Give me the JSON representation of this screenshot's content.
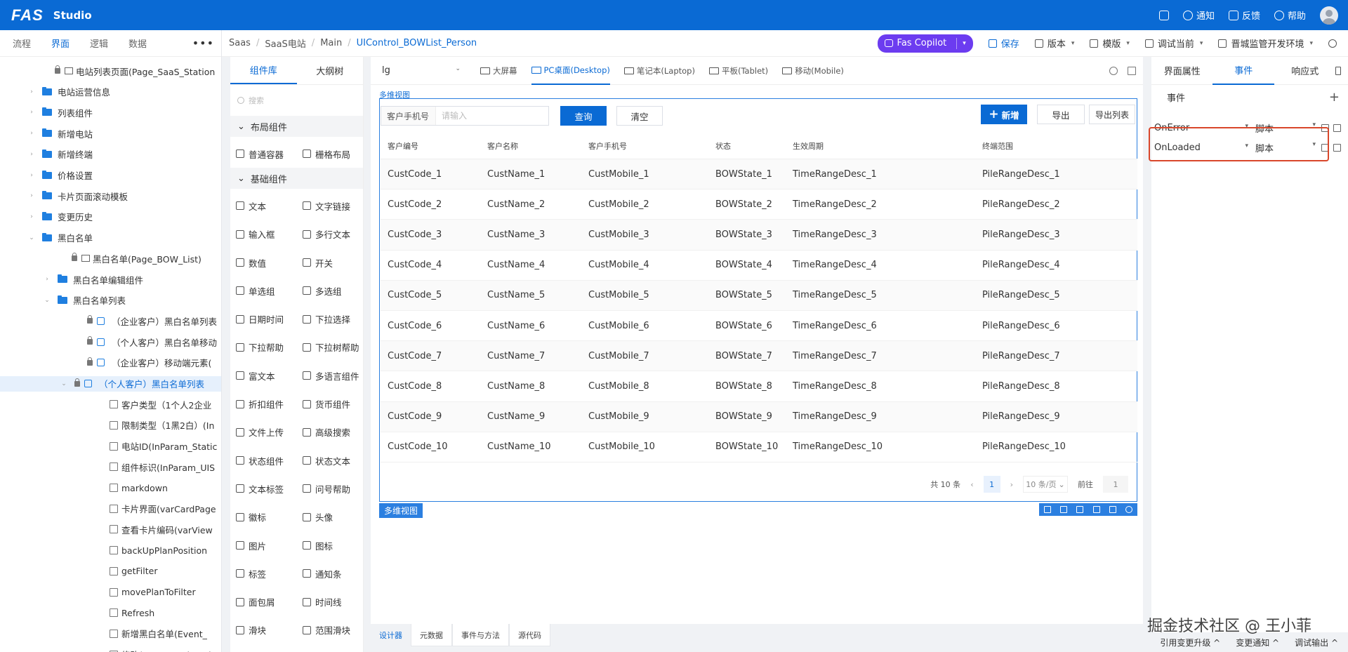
{
  "app": {
    "logo": "FAS",
    "studio": "Studio"
  },
  "topbar": {
    "items": [
      {
        "label": "",
        "icon": "expand-icon"
      },
      {
        "label": "通知",
        "icon": "bell-icon"
      },
      {
        "label": "反馈",
        "icon": "feedback-icon"
      },
      {
        "label": "帮助",
        "icon": "help-icon"
      }
    ]
  },
  "left": {
    "tabs": [
      "流程",
      "界面",
      "逻辑",
      "数据"
    ],
    "active_tab": "界面",
    "tree": [
      {
        "label": "电站列表页面(Page_SaaS_Station",
        "indent": 78,
        "type": "page",
        "lock": true
      },
      {
        "label": "电站运营信息",
        "indent": 60,
        "type": "folder",
        "caret": "›"
      },
      {
        "label": "列表组件",
        "indent": 60,
        "type": "folder",
        "caret": "›"
      },
      {
        "label": "新增电站",
        "indent": 60,
        "type": "folder",
        "caret": "›"
      },
      {
        "label": "新增终端",
        "indent": 60,
        "type": "folder",
        "caret": "›"
      },
      {
        "label": "价格设置",
        "indent": 60,
        "type": "folder",
        "caret": "›"
      },
      {
        "label": "卡片页面滚动模板",
        "indent": 60,
        "type": "folder",
        "caret": "›"
      },
      {
        "label": "变更历史",
        "indent": 60,
        "type": "folder",
        "caret": "›"
      },
      {
        "label": "黑白名单",
        "indent": 60,
        "type": "folder",
        "caret": "⌄"
      },
      {
        "label": "黑白名单(Page_BOW_List)",
        "indent": 102,
        "type": "page",
        "lock": true
      },
      {
        "label": "黑白名单编辑组件",
        "indent": 82,
        "type": "folder",
        "caret": "›"
      },
      {
        "label": "黑白名单列表",
        "indent": 82,
        "type": "folder",
        "caret": "⌄"
      },
      {
        "label": "（企业客户）黑白名单列表",
        "indent": 124,
        "type": "comp",
        "lock": true
      },
      {
        "label": "（个人客户）黑白名单移动",
        "indent": 124,
        "type": "comp",
        "lock": true
      },
      {
        "label": "（企业客户）移动端元素(",
        "indent": 124,
        "type": "comp",
        "lock": true
      },
      {
        "label": "（个人客户）黑白名单列表",
        "indent": 106,
        "type": "comp",
        "lock": true,
        "selected": true,
        "caret": "⌄"
      },
      {
        "label": "客户类型（1个人2企业",
        "indent": 156,
        "type": "prop"
      },
      {
        "label": "限制类型（1黑2白）(In",
        "indent": 156,
        "type": "prop"
      },
      {
        "label": "电站ID(InParam_Static",
        "indent": 156,
        "type": "prop"
      },
      {
        "label": "组件标识(InParam_UIS",
        "indent": 156,
        "type": "prop"
      },
      {
        "label": "markdown",
        "indent": 156,
        "type": "prop"
      },
      {
        "label": "卡片界面(varCardPage",
        "indent": 156,
        "type": "prop"
      },
      {
        "label": "查看卡片编码(varView",
        "indent": 156,
        "type": "prop"
      },
      {
        "label": "backUpPlanPosition",
        "indent": 156,
        "type": "prop"
      },
      {
        "label": "getFilter",
        "indent": 156,
        "type": "prop"
      },
      {
        "label": "movePlanToFilter",
        "indent": 156,
        "type": "prop"
      },
      {
        "label": "Refresh",
        "indent": 156,
        "type": "prop"
      },
      {
        "label": "新增黑白名单(Event_",
        "indent": 156,
        "type": "prop"
      },
      {
        "label": "修改(Event_UpdateLis",
        "indent": 156,
        "type": "prop"
      }
    ]
  },
  "breadcrumb": [
    "Saas",
    "SaaS电站",
    "Main",
    "UIControl_BOWList_Person"
  ],
  "toolbar": {
    "copilot": "Fas Copilot",
    "save": "保存",
    "version": "版本",
    "template": "模版",
    "debug": "调试当前",
    "env": "晋城监管开发环境"
  },
  "library": {
    "tabs": [
      "组件库",
      "大纲树"
    ],
    "search_placeholder": "搜索",
    "groups": [
      {
        "title": "布局组件",
        "items": [
          "普通容器",
          "栅格布局"
        ]
      },
      {
        "title": "基础组件",
        "items": [
          "文本",
          "文字链接",
          "输入框",
          "多行文本",
          "数值",
          "开关",
          "单选组",
          "多选组",
          "日期时间",
          "下拉选择",
          "下拉帮助",
          "下拉树帮助",
          "富文本",
          "多语言组件",
          "折扣组件",
          "货币组件",
          "文件上传",
          "高级搜索",
          "状态组件",
          "状态文本",
          "文本标签",
          "问号帮助",
          "徽标",
          "头像",
          "图片",
          "图标",
          "标签",
          "通知条",
          "面包屑",
          "时间线",
          "滑块",
          "范围滑块"
        ]
      }
    ]
  },
  "designer": {
    "size": "lg",
    "devices": [
      "大屏幕",
      "PC桌面(Desktop)",
      "笔记本(Laptop)",
      "平板(Tablet)",
      "移动(Mobile)"
    ],
    "active_device": "PC桌面(Desktop)",
    "view_label": "多维视图",
    "view_tag": "多维视图",
    "filter_label": "客户手机号",
    "filter_placeholder": "请输入",
    "query": "查询",
    "clear": "清空",
    "add": "新增",
    "export": "导出",
    "export_list": "导出列表",
    "columns": [
      "客户编号",
      "客户名称",
      "客户手机号",
      "状态",
      "生效周期",
      "终端范围"
    ],
    "rows": [
      [
        "CustCode_1",
        "CustName_1",
        "CustMobile_1",
        "BOWState_1",
        "TimeRangeDesc_1",
        "PileRangeDesc_1"
      ],
      [
        "CustCode_2",
        "CustName_2",
        "CustMobile_2",
        "BOWState_2",
        "TimeRangeDesc_2",
        "PileRangeDesc_2"
      ],
      [
        "CustCode_3",
        "CustName_3",
        "CustMobile_3",
        "BOWState_3",
        "TimeRangeDesc_3",
        "PileRangeDesc_3"
      ],
      [
        "CustCode_4",
        "CustName_4",
        "CustMobile_4",
        "BOWState_4",
        "TimeRangeDesc_4",
        "PileRangeDesc_4"
      ],
      [
        "CustCode_5",
        "CustName_5",
        "CustMobile_5",
        "BOWState_5",
        "TimeRangeDesc_5",
        "PileRangeDesc_5"
      ],
      [
        "CustCode_6",
        "CustName_6",
        "CustMobile_6",
        "BOWState_6",
        "TimeRangeDesc_6",
        "PileRangeDesc_6"
      ],
      [
        "CustCode_7",
        "CustName_7",
        "CustMobile_7",
        "BOWState_7",
        "TimeRangeDesc_7",
        "PileRangeDesc_7"
      ],
      [
        "CustCode_8",
        "CustName_8",
        "CustMobile_8",
        "BOWState_8",
        "TimeRangeDesc_8",
        "PileRangeDesc_8"
      ],
      [
        "CustCode_9",
        "CustName_9",
        "CustMobile_9",
        "BOWState_9",
        "TimeRangeDesc_9",
        "PileRangeDesc_9"
      ],
      [
        "CustCode_10",
        "CustName_10",
        "CustMobile_10",
        "BOWState_10",
        "TimeRangeDesc_10",
        "PileRangeDesc_10"
      ]
    ],
    "pager": {
      "total": "共 10 条",
      "page": "1",
      "page_size": "10 条/页",
      "goto": "前往",
      "goto_value": "1"
    },
    "bottom_tabs": [
      "设计器",
      "元数据",
      "事件与方法",
      "源代码"
    ],
    "active_bottom_tab": "设计器"
  },
  "right": {
    "tabs": [
      "界面属性",
      "事件",
      "响应式"
    ],
    "active_tab": "事件",
    "section": "事件",
    "events": [
      {
        "name": "OnError",
        "type": "脚本"
      },
      {
        "name": "OnLoaded",
        "type": "脚本"
      }
    ],
    "highlight_color": "#d9472b"
  },
  "status": [
    "引用变更升级",
    "变更通知",
    "调试输出"
  ],
  "watermark": "掘金技术社区 @ 王小菲",
  "colors": {
    "primary": "#0a6ad4",
    "copilot": "#6c3cf0"
  }
}
